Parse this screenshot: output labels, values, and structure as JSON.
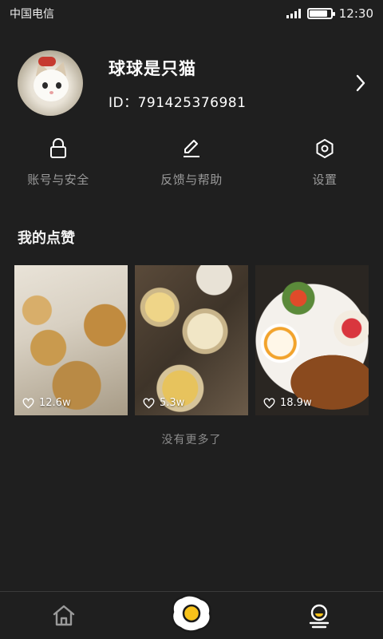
{
  "status_bar": {
    "carrier": "中国电信",
    "time": "12:30",
    "battery_level": 0.85
  },
  "profile": {
    "name": "球球是只猫",
    "id_text": "ID：791425376981",
    "avatar_icon": "cat-avatar"
  },
  "actions": [
    {
      "label": "账号与安全",
      "icon": "lock-icon"
    },
    {
      "label": "反馈与帮助",
      "icon": "edit-icon"
    },
    {
      "label": "设置",
      "icon": "settings-hexagon-icon"
    }
  ],
  "likes_section": {
    "title": "我的点赞",
    "items": [
      {
        "likes": "12.6w"
      },
      {
        "likes": "5.3w"
      },
      {
        "likes": "18.9w"
      }
    ],
    "footer": "没有更多了"
  },
  "tab_bar": {
    "tabs": [
      {
        "icon": "home-icon",
        "active": false
      },
      {
        "icon": "fried-egg-icon",
        "active": false
      },
      {
        "icon": "profile-icon",
        "active": true
      }
    ]
  },
  "colors": {
    "background": "#1f1f1f",
    "accent": "#f7c21a",
    "muted_text": "#9a9a9a"
  }
}
